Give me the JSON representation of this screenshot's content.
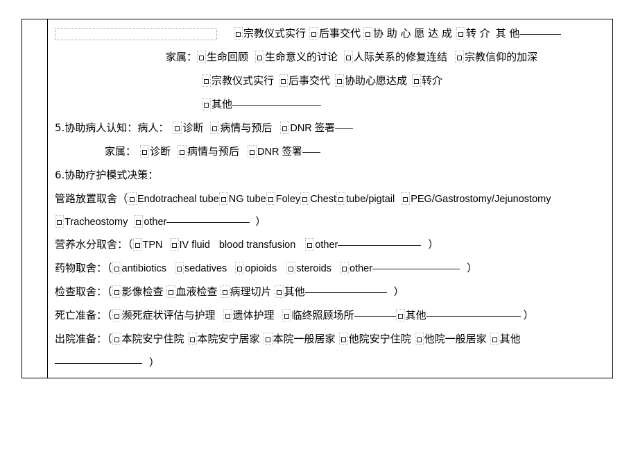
{
  "document": {
    "type": "medical-form-table",
    "language": "zh-CN + en"
  },
  "rows": {
    "r1": {
      "opt1": "宗教仪式实行",
      "opt2": "后事交代",
      "opt3": "协 助 心 愿 达 成",
      "opt4": "转 介",
      "trailing_label": "其 他"
    },
    "r2": {
      "prefix": "家属：",
      "opt1": "生命回顾",
      "opt2": "生命意义的讨论",
      "opt3": "人际关系的修复连结",
      "opt4": "宗教信仰的加深"
    },
    "r3": {
      "opt1": "宗教仪式实行",
      "opt2": "后事交代",
      "opt3": "协助心愿达成",
      "opt4": "转介"
    },
    "r4": {
      "opt1": "其他"
    },
    "sec5": {
      "title": "5.协助病人认知：",
      "patient_label": "病人：",
      "family_label": "家属：",
      "opt1": "诊断",
      "opt2": "病情与预后",
      "opt3": "DNR 签署"
    },
    "sec6": {
      "title": "6.协助疗护模式决策："
    },
    "tubes": {
      "label": "管路放置取舍（",
      "opt1": "Endotracheal tube",
      "opt2": "NG tube",
      "opt3": "Foley",
      "opt4a": "Chest",
      "opt4b": "tube/pigtail",
      "opt5": "PEG/Gastrostomy/Jejunostomy",
      "opt6": "Tracheostomy",
      "opt7": "other",
      "close": "）"
    },
    "nutrition": {
      "label": "营养水分取舍：（",
      "opt1": "TPN",
      "opt2": "IV fluid",
      "opt3": "blood transfusion",
      "opt4": "other",
      "close": "）"
    },
    "drugs": {
      "label": "药物取舍：（",
      "opt1": "antibiotics",
      "opt2": "sedatives",
      "opt3": "opioids",
      "opt4": "steroids",
      "opt5": "other",
      "close": "）"
    },
    "exams": {
      "label": "检查取舍：（",
      "opt1": "影像检查",
      "opt2": "血液检查",
      "opt3": "病理切片",
      "opt4": "其他",
      "close": "）"
    },
    "death_prep": {
      "label": "死亡准备：（",
      "opt1": "濒死症状评估与护理",
      "opt2": "遗体护理",
      "opt3": "临终照顾场所",
      "opt4": "其他",
      "close": "）"
    },
    "discharge": {
      "label": "出院准备：（",
      "opt1": "本院安宁住院",
      "opt2": "本院安宁居家",
      "opt3": "本院一般居家",
      "opt4": "他院安宁住院",
      "opt5": "他院一般居家",
      "opt6": "其他",
      "close": "）"
    }
  }
}
